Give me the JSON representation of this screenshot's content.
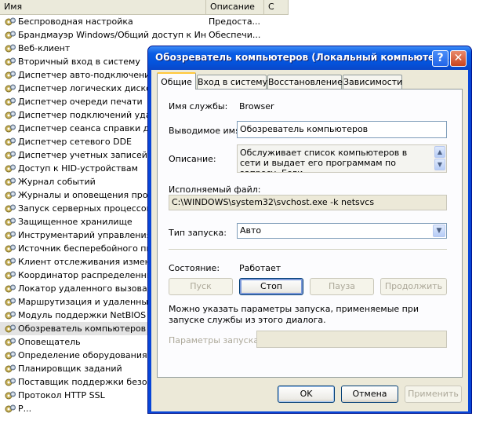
{
  "list": {
    "columns": {
      "name": "Имя",
      "description": "Описание",
      "state": "С"
    },
    "rows": [
      {
        "name": "Беспроводная настройка",
        "desc": "Предоста..."
      },
      {
        "name": "Брандмауэр Windows/Общий доступ к Инте...",
        "desc": "Обеспечи..."
      },
      {
        "name": "Веб-клиент",
        "desc": ""
      },
      {
        "name": "Вторичный вход в систему",
        "desc": ""
      },
      {
        "name": "Диспетчер авто-подключений у",
        "desc": ""
      },
      {
        "name": "Диспетчер логических дисков",
        "desc": ""
      },
      {
        "name": "Диспетчер очереди печати",
        "desc": ""
      },
      {
        "name": "Диспетчер подключений удален",
        "desc": ""
      },
      {
        "name": "Диспетчер сеанса справки для у",
        "desc": ""
      },
      {
        "name": "Диспетчер сетевого DDE",
        "desc": ""
      },
      {
        "name": "Диспетчер учетных записей безо",
        "desc": ""
      },
      {
        "name": "Доступ к HID-устройствам",
        "desc": ""
      },
      {
        "name": "Журнал событий",
        "desc": ""
      },
      {
        "name": "Журналы и оповещения произво",
        "desc": ""
      },
      {
        "name": "Запуск серверных процессов DC",
        "desc": ""
      },
      {
        "name": "Защищенное хранилище",
        "desc": ""
      },
      {
        "name": "Инструментарий управления Win",
        "desc": ""
      },
      {
        "name": "Источник бесперебойного питан",
        "desc": ""
      },
      {
        "name": "Клиент отслеживания изменивш",
        "desc": ""
      },
      {
        "name": "Координатор распределенных т",
        "desc": ""
      },
      {
        "name": "Локатор удаленного вызова про",
        "desc": ""
      },
      {
        "name": "Маршрутизация и удаленный до",
        "desc": ""
      },
      {
        "name": "Модуль поддержки NetBIOS чере",
        "desc": ""
      },
      {
        "name": "Обозреватель компьютеров",
        "desc": "",
        "selected": true
      },
      {
        "name": "Оповещатель",
        "desc": ""
      },
      {
        "name": "Определение оборудования обо",
        "desc": ""
      },
      {
        "name": "Планировщик заданий",
        "desc": ""
      },
      {
        "name": "Поставщик поддержки безопасн",
        "desc": ""
      },
      {
        "name": "Протокол HTTP SSL",
        "desc": ""
      },
      {
        "name": "Р...",
        "desc": ""
      }
    ]
  },
  "dialog": {
    "title": "Обозреватель компьютеров (Локальный компьютер)...",
    "help_glyph": "?",
    "close_glyph": "✕",
    "tabs": [
      "Общие",
      "Вход в систему",
      "Восстановление",
      "Зависимости"
    ],
    "service_name_label": "Имя службы:",
    "service_name": "Browser",
    "display_name_label": "Выводимое имя:",
    "display_name": "Обозреватель компьютеров",
    "description_label": "Описание:",
    "description": "Обслуживает список компьютеров в сети и выдает его программам по запросу. Если",
    "exe_label": "Исполняемый файл:",
    "exe_path": "C:\\WINDOWS\\system32\\svchost.exe -k netsvcs",
    "startup_label": "Тип запуска:",
    "startup_value": "Авто",
    "status_label": "Состояние:",
    "status_value": "Работает",
    "btn_start": "Пуск",
    "btn_stop": "Стоп",
    "btn_pause": "Пауза",
    "btn_resume": "Продолжить",
    "hint": "Можно указать параметры запуска, применяемые при запуске службы из этого диалога.",
    "params_label": "Параметры запуска:",
    "params_value": "",
    "btn_ok": "OK",
    "btn_cancel": "Отмена",
    "btn_apply": "Применить"
  },
  "colors": {
    "titlebar": "#0a5ce5",
    "dialog_bg": "#ece9d8",
    "selected_row": "#e3e3e3"
  }
}
